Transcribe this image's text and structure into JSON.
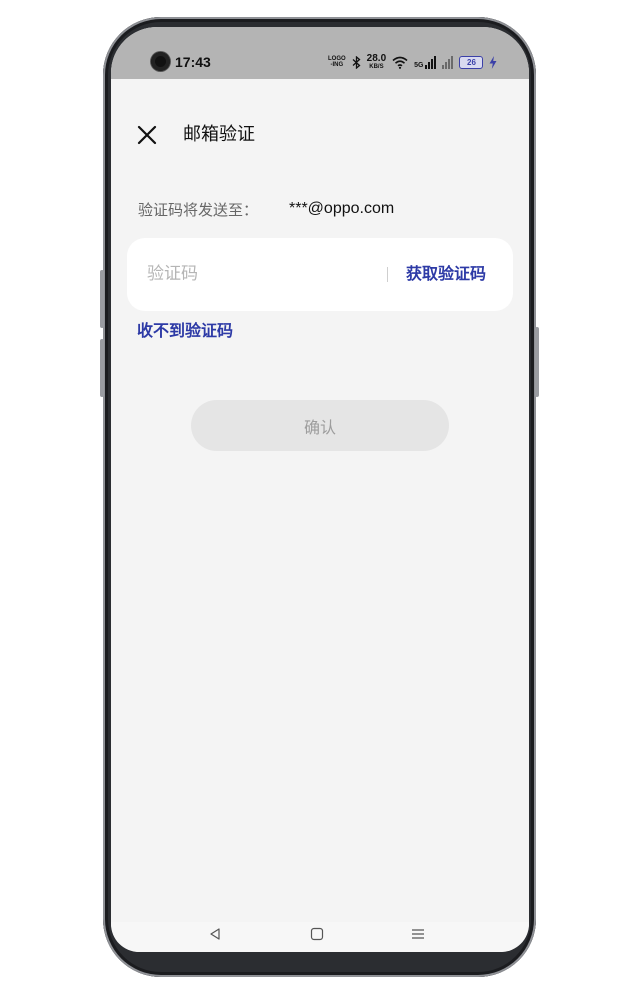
{
  "status_bar": {
    "time": "17:43",
    "logo_text_top": "LOGO",
    "logo_text_bottom": "-ING",
    "net_speed_value": "28.0",
    "net_speed_unit": "KB/S",
    "signal_label": "5G",
    "battery_level": "26",
    "accent_color": "#3b40a8",
    "icons": [
      "camera-cutout",
      "bluetooth-icon",
      "wifi-icon",
      "cellular-signal-icon",
      "cellular-signal-2-icon",
      "battery-icon",
      "charging-icon"
    ]
  },
  "header": {
    "title": "邮箱验证",
    "close_icon": "close-icon"
  },
  "send_info": {
    "label": "验证码将发送至：",
    "email": "***@oppo.com"
  },
  "code_field": {
    "placeholder": "验证码",
    "value": "",
    "get_code_label": "获取验证码"
  },
  "links": {
    "no_code_label": "收不到验证码"
  },
  "confirm_button": {
    "label": "确认",
    "state": "disabled"
  },
  "nav_bar": {
    "icons": [
      "back-icon",
      "home-icon",
      "recents-icon"
    ]
  },
  "colors": {
    "accent": "#2d3aa6",
    "background": "#f4f4f4",
    "button_disabled": "#e5e5e5"
  }
}
